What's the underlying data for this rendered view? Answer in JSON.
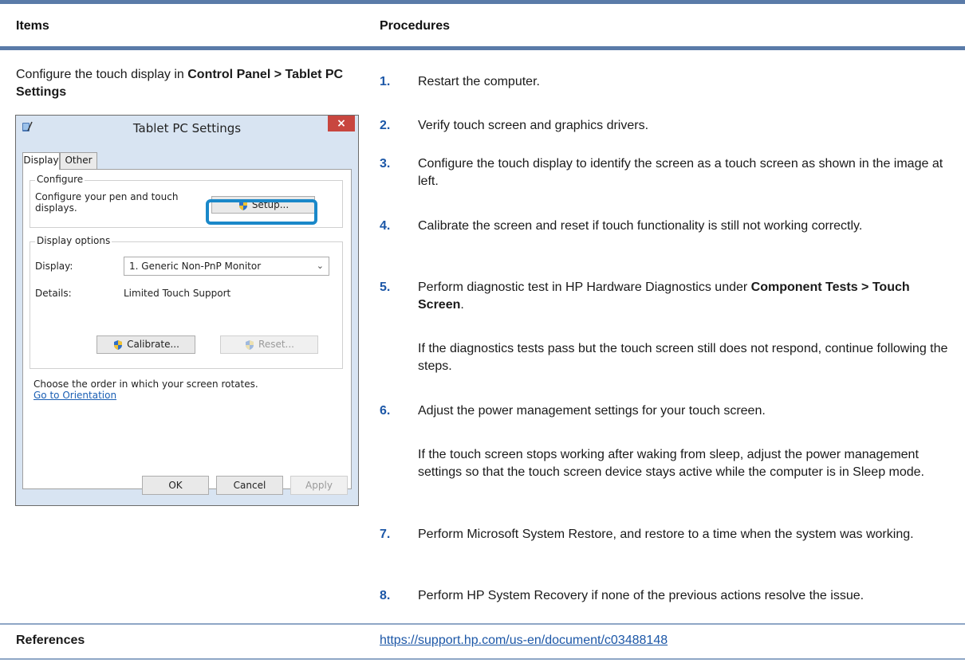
{
  "header": {
    "items": "Items",
    "procedures": "Procedures"
  },
  "left": {
    "intro_prefix": "Configure the touch display in ",
    "intro_bold": "Control Panel > Tablet PC Settings"
  },
  "dialog": {
    "title": "Tablet PC Settings",
    "close": "×",
    "tabs": [
      "Display",
      "Other"
    ],
    "configure_group": "Configure",
    "configure_text": "Configure your pen and touch displays.",
    "setup_button": "Setup...",
    "display_options_group": "Display options",
    "display_label": "Display:",
    "display_value": "1. Generic Non-PnP Monitor",
    "details_label": "Details:",
    "details_value": "Limited Touch Support",
    "calibrate_button": "Calibrate...",
    "reset_button": "Reset...",
    "orientation_text": "Choose the order in which your screen rotates.",
    "orientation_link": "Go to Orientation",
    "ok_button": "OK",
    "cancel_button": "Cancel",
    "apply_button": "Apply"
  },
  "steps": [
    {
      "num": "1.",
      "text": "Restart the computer."
    },
    {
      "num": "2.",
      "text": "Verify touch screen and graphics drivers."
    },
    {
      "num": "3.",
      "text": "Configure the touch display to identify the screen as a touch screen as shown in the image at left."
    },
    {
      "num": "4.",
      "text": "Calibrate the screen and reset if touch functionality is still not working correctly."
    },
    {
      "num": "5.",
      "text": "Perform diagnostic test in HP Hardware Diagnostics under ",
      "bold": "Component Tests > Touch Screen",
      "tail": "."
    },
    {
      "num": "6.",
      "text": "Adjust the power management settings for your touch screen."
    },
    {
      "num": "7.",
      "text": "Perform Microsoft System Restore, and restore to a time when the system was working."
    },
    {
      "num": "8.",
      "text": "Perform HP System Recovery if none of the previous actions resolve the issue."
    }
  ],
  "step5_note": "If the diagnostics tests pass but the touch screen still does not respond, continue following the steps.",
  "step6_note": "If the touch screen stops working after waking from sleep, adjust the power management settings so that the touch screen device stays active while the computer is in Sleep mode.",
  "references": {
    "label": "References",
    "link": "https://support.hp.com/us-en/document/c03488148"
  },
  "colors": {
    "rule": "#5a7ba8",
    "accent": "#1c57a7",
    "highlight": "#1a88c9"
  }
}
